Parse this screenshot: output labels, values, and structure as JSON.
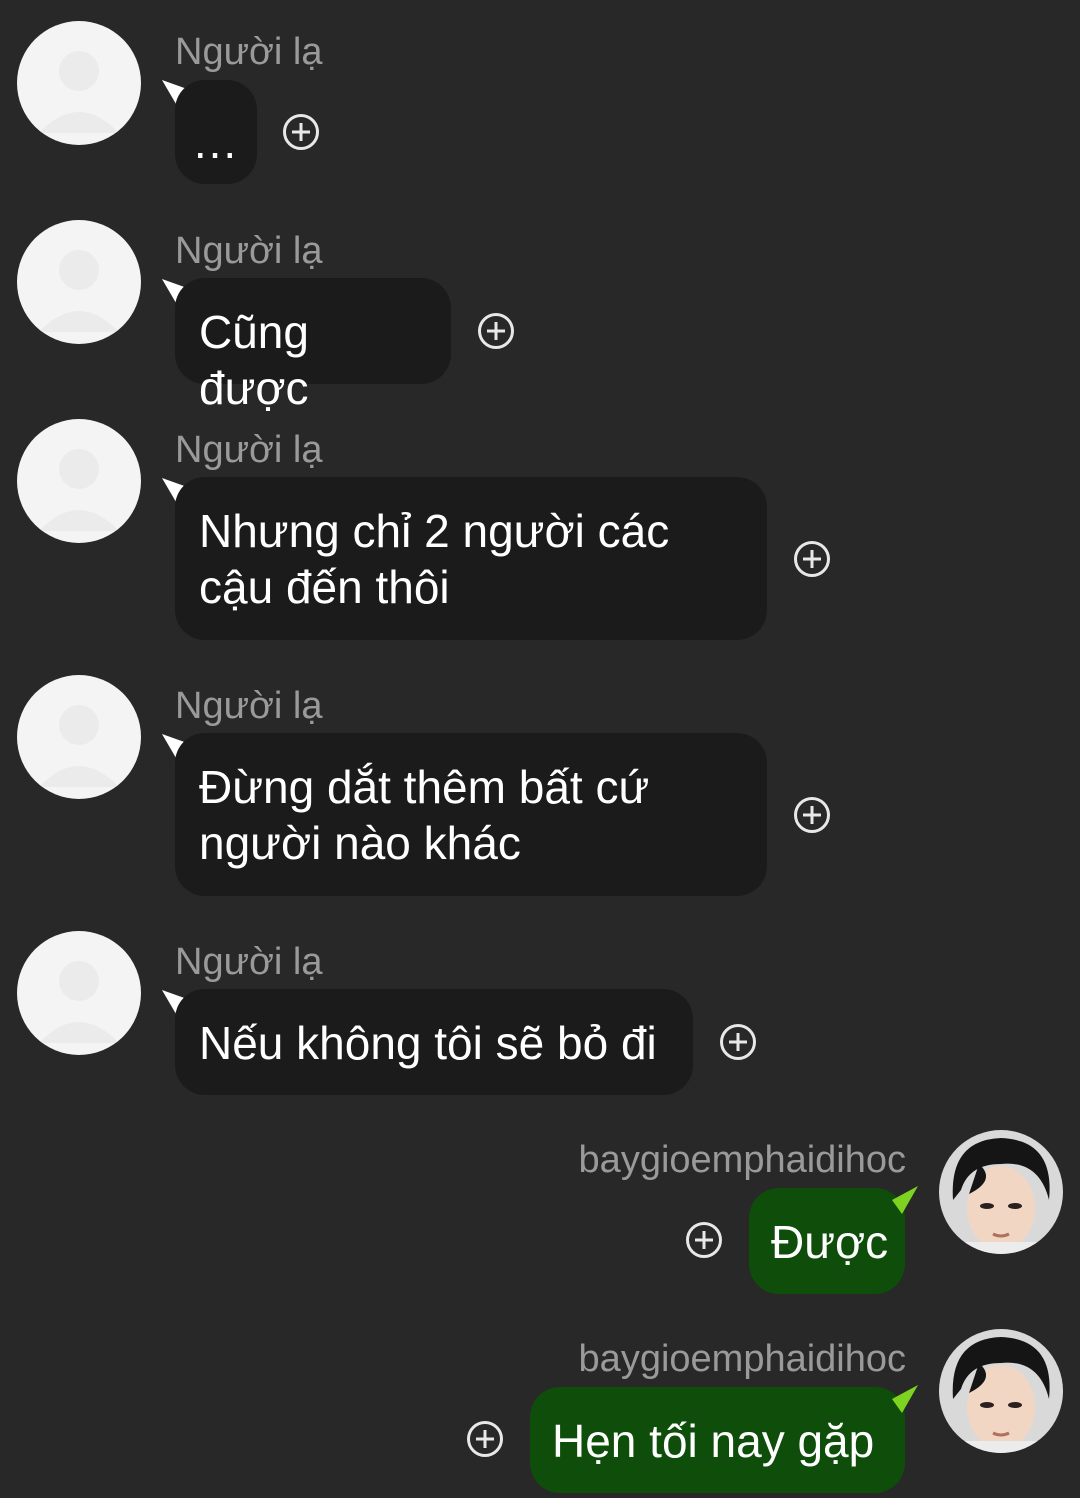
{
  "messages": [
    {
      "sender": "Người lạ",
      "text": "...",
      "direction": "incoming",
      "avatar_icon": "default-user-silhouette"
    },
    {
      "sender": "Người lạ",
      "text": "Cũng được",
      "direction": "incoming",
      "avatar_icon": "default-user-silhouette"
    },
    {
      "sender": "Người lạ",
      "text": "Nhưng chỉ 2 người các cậu đến thôi",
      "direction": "incoming",
      "avatar_icon": "default-user-silhouette"
    },
    {
      "sender": "Người lạ",
      "text": "Đừng dắt thêm bất cứ người nào khác",
      "direction": "incoming",
      "avatar_icon": "default-user-silhouette"
    },
    {
      "sender": "Người lạ",
      "text": "Nếu không tôi sẽ bỏ đi",
      "direction": "incoming",
      "avatar_icon": "default-user-silhouette"
    },
    {
      "sender": "baygioemphaidihoc",
      "text": "Được",
      "direction": "outgoing",
      "avatar_icon": "user-photo"
    },
    {
      "sender": "baygioemphaidihoc",
      "text": "Hẹn tối nay gặp",
      "direction": "outgoing",
      "avatar_icon": "user-photo"
    }
  ],
  "colors": {
    "background": "#282828",
    "incoming_bubble": "#1b1b1b",
    "outgoing_bubble": "#0f4d0a",
    "outgoing_tail": "#7ed321",
    "sender_name": "#9a9a9a"
  },
  "icons": {
    "add_reaction": "plus-circle-icon"
  }
}
